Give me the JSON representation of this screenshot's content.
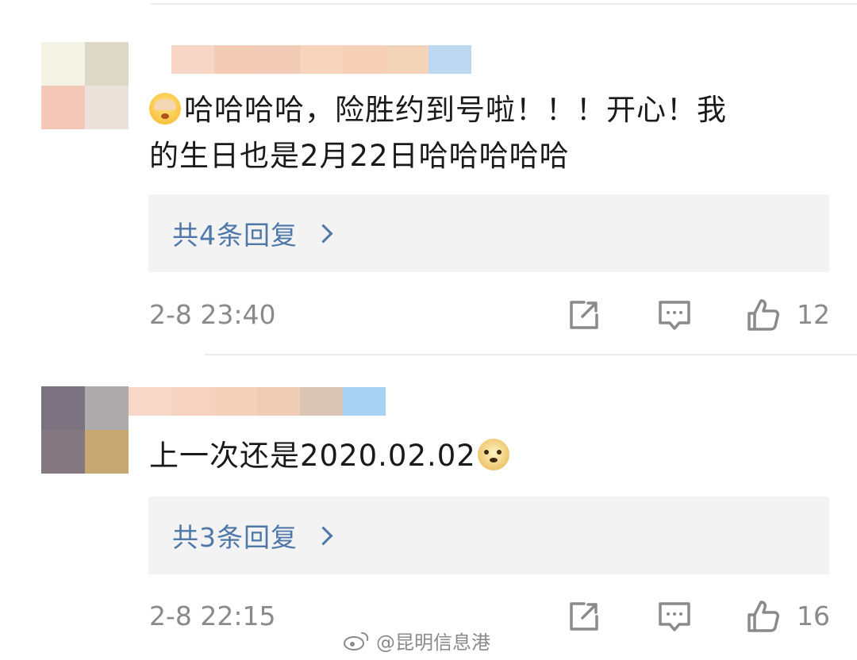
{
  "comments": [
    {
      "text_line1": "哈哈哈哈，险胜约到号啦！！！开心！我",
      "text_line2": "的生日也是2月22日哈哈哈哈哈",
      "leading_emoji": "facepalm-emoji",
      "reply_label": "共4条回复",
      "timestamp": "2-8 23:40",
      "like_count": "12",
      "avatar_colors": [
        "#f5f2e6",
        "#dcd9c9",
        "#f3c8b7",
        "#ebe2dc"
      ],
      "username_colors": [
        "#f8d6c5",
        "#f4ccb6",
        "#f2ccb6",
        "#f8d4bd",
        "#f5d0b6",
        "#f3d4b9",
        "#bcd7f0"
      ]
    },
    {
      "text": "上一次还是2020.02.02",
      "trailing_emoji": "doge-emoji",
      "reply_label": "共3条回复",
      "timestamp": "2-8 22:15",
      "like_count": "16",
      "avatar_colors": [
        "#7b7480",
        "#aeabad",
        "#857880",
        "#c7a875"
      ],
      "username_colors": [
        "#f8d7c8",
        "#f6d2c0",
        "#f3d1bb",
        "#f0cdb5",
        "#dbc5b5",
        "#a9d3f4"
      ]
    }
  ],
  "icons": {
    "share": "share-icon",
    "comment": "comment-icon",
    "like": "thumbs-up-icon",
    "reply_arrow": "chevron-right-icon",
    "watermark_logo": "weibo-icon"
  },
  "watermark": "@昆明信息港",
  "colors": {
    "link": "#4e78a8",
    "meta": "#8a8a8a",
    "reply_bg": "#f3f3f3",
    "text": "#1a1a1a"
  }
}
